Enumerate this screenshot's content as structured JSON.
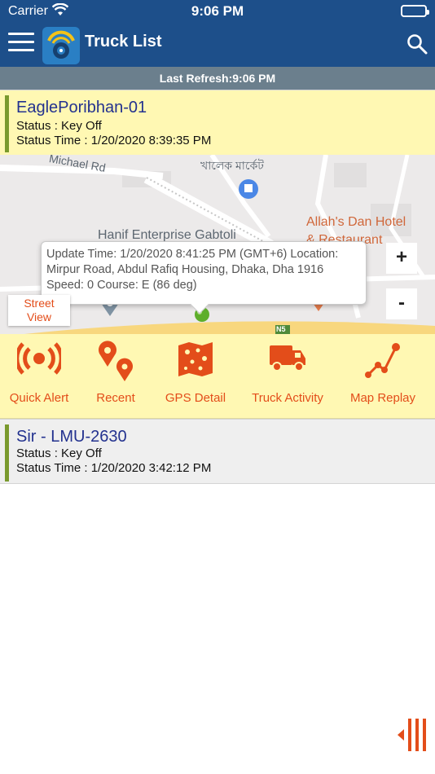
{
  "status_bar": {
    "carrier": "Carrier",
    "time": "9:06 PM"
  },
  "nav": {
    "title": "Truck List"
  },
  "refresh": {
    "text": "Last Refresh:9:06 PM"
  },
  "trucks": [
    {
      "name": "EaglePoribhan-01",
      "status": "Status : Key Off",
      "status_time": "Status Time : 1/20/2020 8:39:35 PM"
    },
    {
      "name": "Sir - LMU-2630",
      "status": "Status : Key Off",
      "status_time": "Status Time : 1/20/2020 3:42:12 PM"
    }
  ],
  "map": {
    "labels": {
      "road": "Michael Rd",
      "market": "খালেক মার্কেট",
      "enterprise": "Hanif Enterprise Gabtoli",
      "hotel_1": "Allah's Dan Hotel",
      "hotel_2": "& Restaurant",
      "highway": "N5"
    },
    "zoom_in": "+",
    "zoom_out": "-",
    "street_view_1": "Street",
    "street_view_2": "View",
    "popup": {
      "line_1": "Update Time: 1/20/2020 8:41:25 PM (GMT+6) Location:",
      "line_2": "Mirpur Road, Abdul Rafiq Housing, Dhaka, Dha 1916",
      "line_3": "Speed: 0 Course: E (86 deg)"
    }
  },
  "actions": [
    {
      "label": "Quick Alert",
      "icon": "alert-icon"
    },
    {
      "label": "Recent",
      "icon": "location-pins-icon"
    },
    {
      "label": "GPS Detail",
      "icon": "map-icon"
    },
    {
      "label": "Truck Activity",
      "icon": "truck-icon"
    },
    {
      "label": "Map Replay",
      "icon": "route-icon"
    }
  ],
  "colors": {
    "header_blue": "#1d4f8a",
    "refresh_gray": "#6b7f8d",
    "card_yellow": "#fff8b3",
    "accent_green": "#7a9a2e",
    "action_orange": "#e34d1a",
    "title_navy": "#23328f"
  }
}
